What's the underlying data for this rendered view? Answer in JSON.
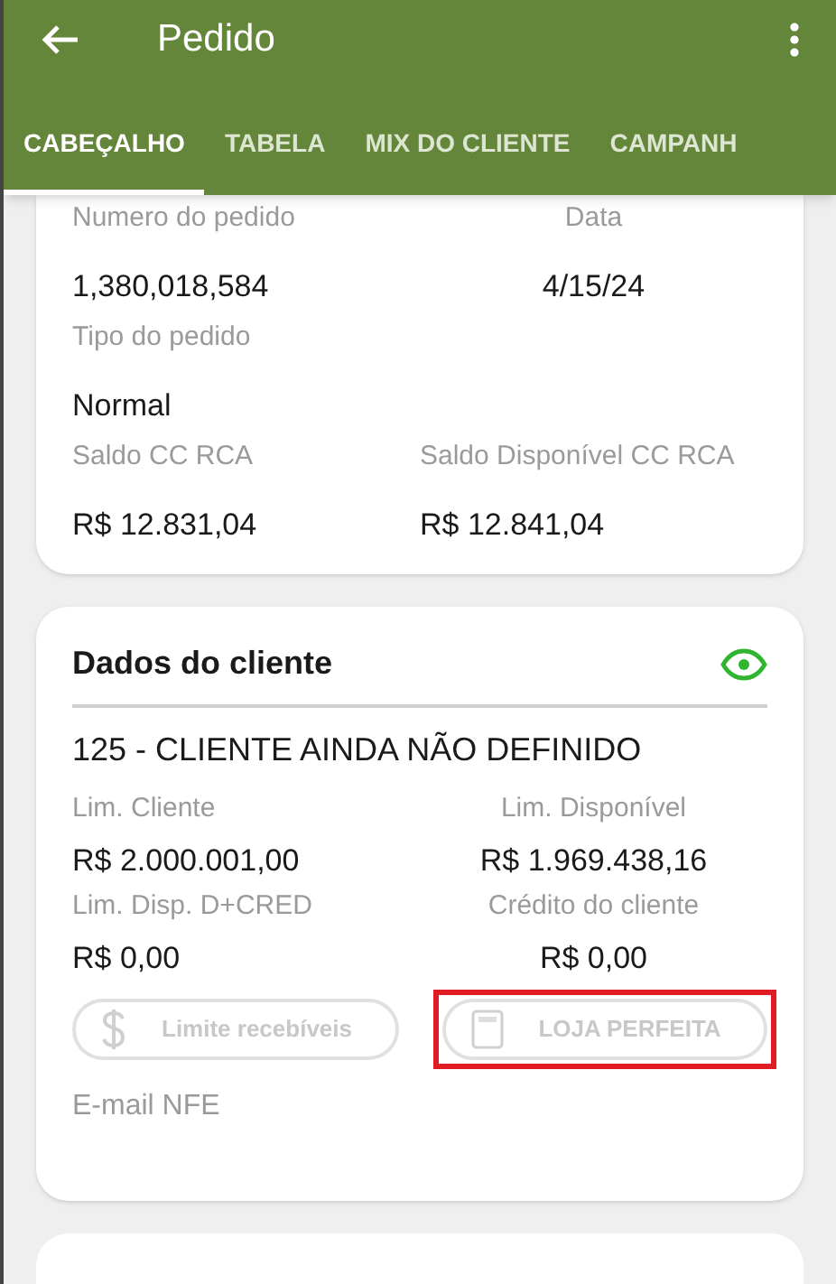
{
  "app_bar": {
    "title": "Pedido"
  },
  "tabs": [
    {
      "label": "CABEÇALHO",
      "selected": true
    },
    {
      "label": "TABELA",
      "selected": false
    },
    {
      "label": "MIX DO CLIENTE",
      "selected": false
    },
    {
      "label": "CAMPANH",
      "selected": false
    }
  ],
  "order_card": {
    "fields": [
      {
        "label": "Numero do pedido",
        "value": "1,380,018,584"
      },
      {
        "label": "Data",
        "value": "4/15/24"
      },
      {
        "label": "Tipo do pedido",
        "value": "Normal"
      },
      {
        "label": "Saldo CC RCA",
        "value": "R$ 12.831,04"
      },
      {
        "label": "Saldo Disponível CC RCA",
        "value": "R$ 12.841,04"
      }
    ]
  },
  "client_card": {
    "title": "Dados do cliente",
    "client": "125 - CLIENTE AINDA NÃO DEFINIDO",
    "fields": [
      {
        "label": "Lim. Cliente",
        "value": "R$ 2.000.001,00"
      },
      {
        "label": "Lim. Disponível",
        "value": "R$ 1.969.438,16"
      },
      {
        "label": "Lim. Disp. D+CRED",
        "value": "R$ 0,00"
      },
      {
        "label": "Crédito do cliente",
        "value": "R$ 0,00"
      }
    ],
    "buttons": [
      {
        "label": "Limite recebíveis",
        "disabled": true,
        "highlighted": false
      },
      {
        "label": "LOJA PERFEITA",
        "disabled": true,
        "highlighted": true
      }
    ],
    "email_label": "E-mail NFE"
  }
}
